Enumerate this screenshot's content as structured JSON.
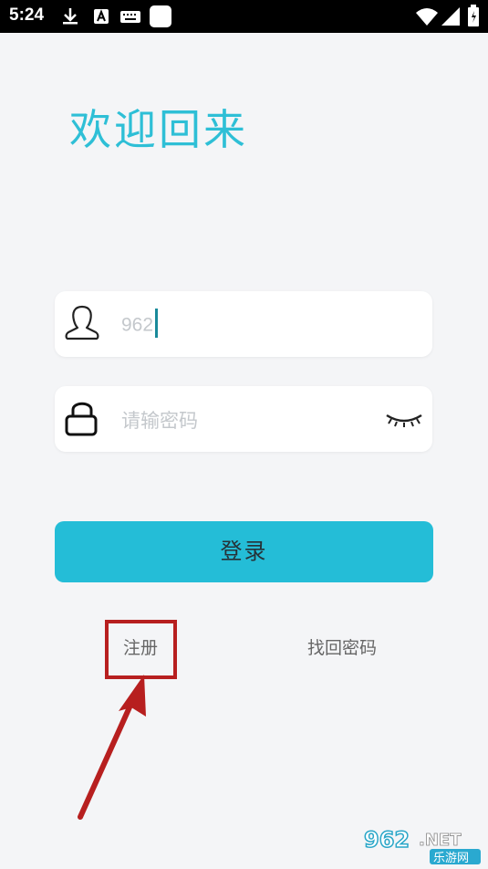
{
  "status_bar": {
    "time": "5:24",
    "icons": [
      "download-icon",
      "a-icon",
      "keyboard-icon",
      "square-icon",
      "wifi-icon",
      "signal-icon",
      "battery-icon"
    ]
  },
  "header": {
    "welcome_text": "欢迎回来"
  },
  "username_field": {
    "value": "962",
    "icon": "user-icon"
  },
  "password_field": {
    "placeholder": "请输密码",
    "icon": "lock-icon",
    "toggle_icon": "eye-closed-icon"
  },
  "login_button": {
    "label": "登录"
  },
  "links": {
    "register": "注册",
    "forgot_password": "找回密码"
  },
  "annotation": {
    "color": "#b71f1f"
  },
  "watermark": {
    "top": "962",
    "net": ".NET",
    "bottom": "乐游网"
  },
  "colors": {
    "accent": "#24bdd7",
    "title": "#2ebfd6",
    "background": "#f4f5f7"
  }
}
